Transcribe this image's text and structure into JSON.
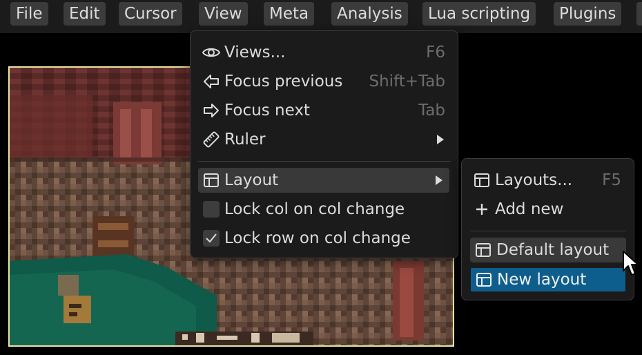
{
  "menubar": {
    "items": [
      {
        "label": "File"
      },
      {
        "label": "Edit"
      },
      {
        "label": "Cursor"
      },
      {
        "label": "View"
      },
      {
        "label": "Meta"
      },
      {
        "label": "Analysis"
      },
      {
        "label": "Lua scripting"
      },
      {
        "label": "Plugins"
      }
    ]
  },
  "view_menu": {
    "items": [
      {
        "label": "Views...",
        "shortcut": "F6",
        "icon": "eye-icon"
      },
      {
        "label": "Focus previous",
        "shortcut": "Shift+Tab",
        "icon": "arrow-left-icon"
      },
      {
        "label": "Focus next",
        "shortcut": "Tab",
        "icon": "arrow-right-icon"
      },
      {
        "label": "Ruler",
        "icon": "ruler-icon",
        "submenu": true
      },
      {
        "label": "Layout",
        "icon": "layout-icon",
        "submenu": true,
        "highlighted": true
      },
      {
        "label": "Lock col on col change",
        "checked": false
      },
      {
        "label": "Lock row on col change",
        "checked": true
      }
    ]
  },
  "layout_menu": {
    "items": [
      {
        "label": "Layouts...",
        "shortcut": "F5",
        "icon": "layout-icon"
      },
      {
        "label": "Add new",
        "icon": "plus-icon"
      },
      {
        "label": "Default layout",
        "icon": "layout-icon",
        "hovered": true
      },
      {
        "label": "New layout",
        "icon": "layout-icon",
        "selected": true
      }
    ]
  },
  "colors": {
    "menubar_bg": "#1b1b1b",
    "menu_button_bg": "#3b3b3b",
    "menu_bg": "#1b1b1b",
    "highlight_bg": "#393939",
    "selection_bg": "#0d5e8d",
    "shortcut_text": "#6d6d6d",
    "canvas_border": "#e9e6a6"
  }
}
